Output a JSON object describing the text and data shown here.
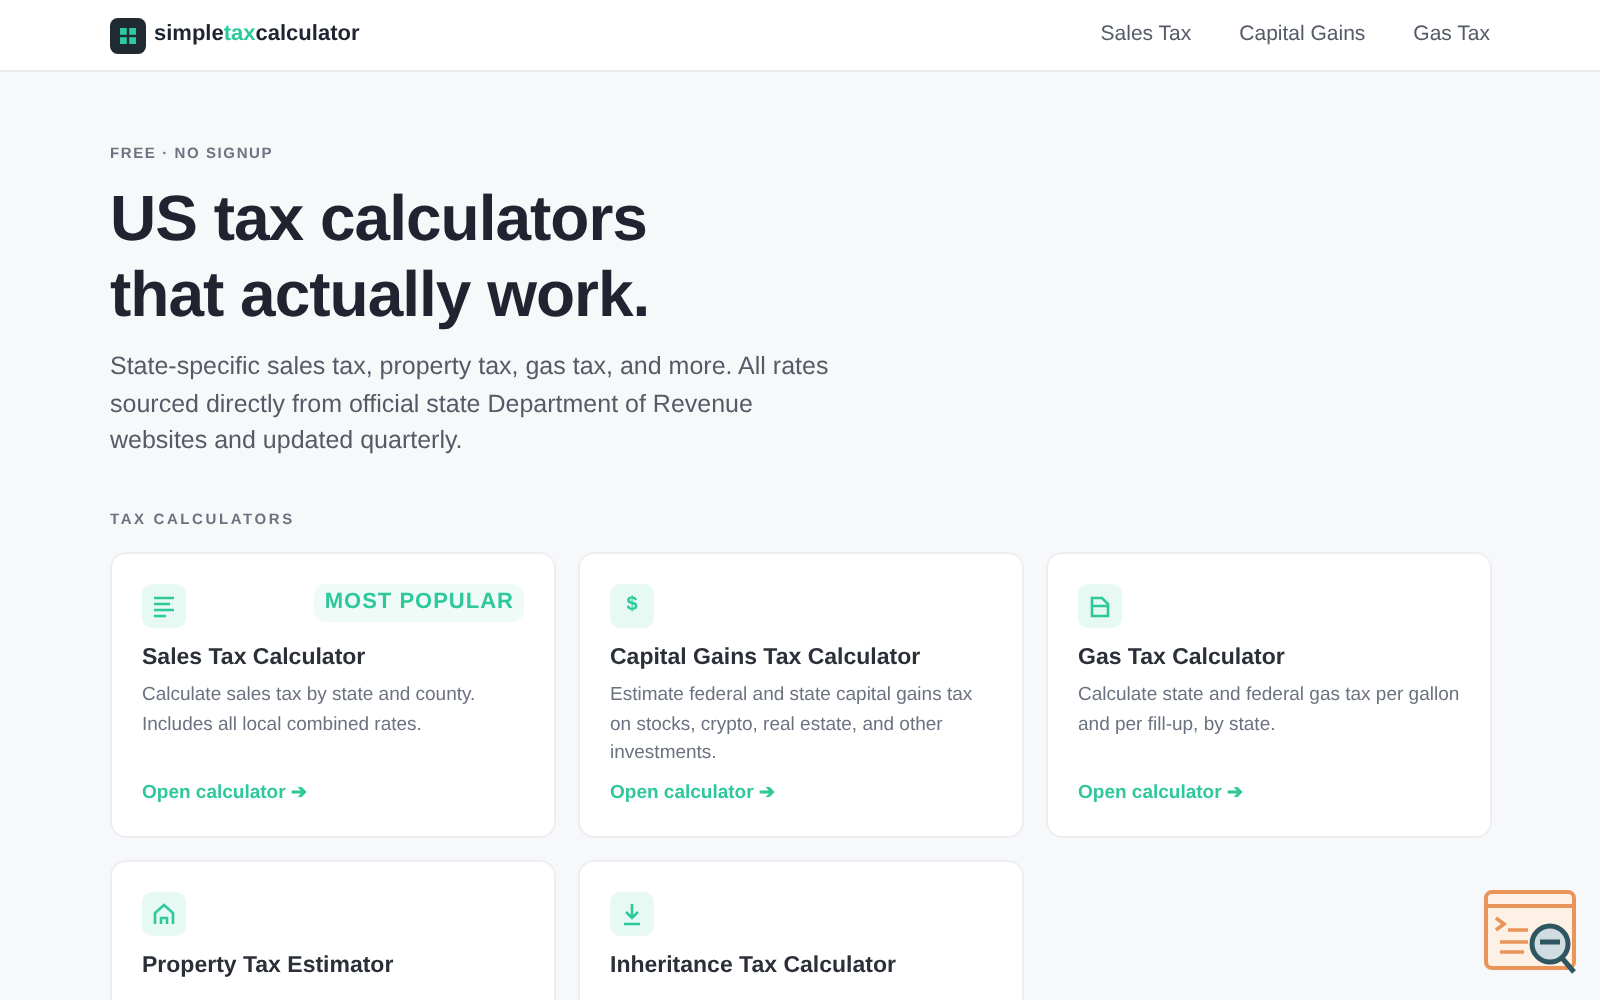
{
  "header": {
    "logo": {
      "before": "simple",
      "highlight": "tax",
      "after": "calculator"
    },
    "nav": [
      {
        "label": "Sales Tax"
      },
      {
        "label": "Capital Gains"
      },
      {
        "label": "Gas Tax"
      }
    ]
  },
  "hero": {
    "eyebrow": "FREE · NO SIGNUP",
    "title_lines": [
      "US tax calculators",
      "that actually work."
    ],
    "description": "State-specific sales tax, property tax, gas tax, and more. All rates sourced directly from official state Department of Revenue websites and updated quarterly."
  },
  "section": {
    "label": "TAX CALCULATORS",
    "cards": [
      {
        "kind": "lines",
        "badge": "MOST POPULAR",
        "title": "Sales Tax Calculator",
        "description": "Calculate sales tax by state and county. Includes all local combined rates.",
        "link": "Open calculator ➔"
      },
      {
        "kind": "symbol",
        "symbol": "$",
        "title": "Capital Gains Tax Calculator",
        "description": "Estimate federal and state capital gains tax on stocks, crypto, real estate, and other investments.",
        "link": "Open calculator ➔"
      },
      {
        "kind": "pump",
        "title": "Gas Tax Calculator",
        "description": "Calculate state and federal gas tax per gallon and per fill-up, by state.",
        "link": "Open calculator ➔"
      },
      {
        "kind": "house",
        "title": "Property Tax Estimator"
      },
      {
        "kind": "download",
        "title": "Inheritance Tax Calculator"
      }
    ]
  }
}
